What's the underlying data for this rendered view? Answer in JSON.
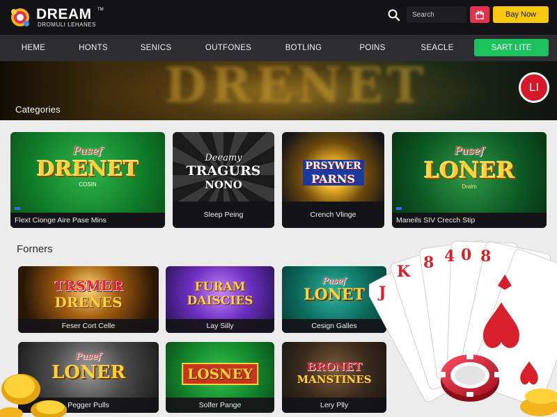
{
  "brand": {
    "name": "DREAM",
    "tm": "TM",
    "tagline": "DROMULI LEHANES"
  },
  "header": {
    "search_placeholder": "Search",
    "gift_icon": "gift-icon",
    "buy_label": "Bay Now"
  },
  "nav": {
    "items": [
      "HEME",
      "HONTS",
      "SENICS",
      "OUTFONES",
      "BOTLING",
      "POINS",
      "SEACLE"
    ],
    "cta": "SART LITE"
  },
  "hero": {
    "banner_text": "DRENET",
    "title": "Categories",
    "avatar_initials": "LI"
  },
  "colors": {
    "header_bg": "#131316",
    "nav_bg": "#2c2c31",
    "accent_yellow": "#f8c80d",
    "accent_green": "#19c25a",
    "accent_red": "#e5304e",
    "page_bg": "#ececec"
  },
  "categories": [
    {
      "script": "Pusef",
      "word": "DRENET",
      "sub": "COSIN",
      "label": "Flext Cionge Aire Pase Mins"
    },
    {
      "script": "Deeamy",
      "word": "TRAGURS",
      "sub": "NONO",
      "label": "Sleep Peing"
    },
    {
      "script": "",
      "word": "PRSYWER",
      "sub": "PARNS",
      "label": "Crench Vlinge"
    },
    {
      "script": "Pusef",
      "word": "LONER",
      "sub": "Dralm",
      "label": "Maneils SIV Crecch Stip"
    }
  ],
  "featured": {
    "title": "Forners",
    "row1": [
      {
        "script": "",
        "word": "TRSMER",
        "sub": "DRENES",
        "label": "Feser Cort Celle"
      },
      {
        "script": "",
        "word": "FURAM",
        "sub": "DAISCIES",
        "label": "Lay Silly"
      },
      {
        "script": "Pusef",
        "word": "LONET",
        "sub": "",
        "label": "Cesign Galles"
      }
    ],
    "row2": [
      {
        "script": "Pusef",
        "word": "LONER",
        "sub": "",
        "label": "Pegger Pulls"
      },
      {
        "script": "",
        "word": "LOSNEY",
        "sub": "",
        "label": "Solfer Pange"
      },
      {
        "script": "",
        "word": "BRONET",
        "sub": "MANSTINES",
        "label": "Lery Plly"
      }
    ]
  },
  "playing_cards": [
    "J",
    "K",
    "8",
    "4",
    "0",
    "8"
  ]
}
